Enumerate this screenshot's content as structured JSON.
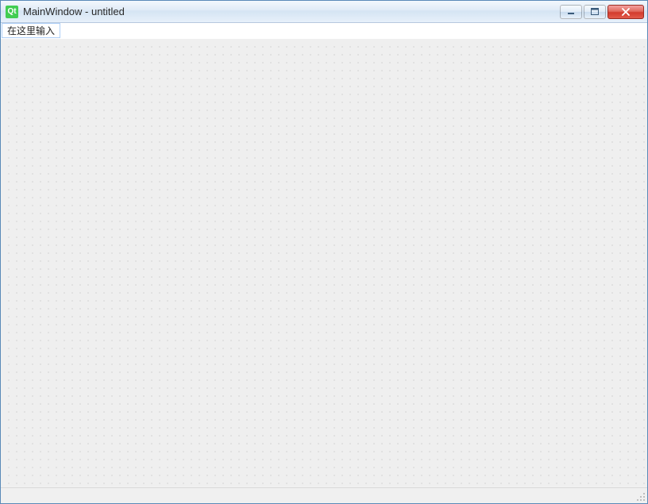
{
  "titlebar": {
    "app_icon_label": "Qt",
    "title": "MainWindow - untitled"
  },
  "menubar": {
    "placeholder": "在这里输入"
  }
}
